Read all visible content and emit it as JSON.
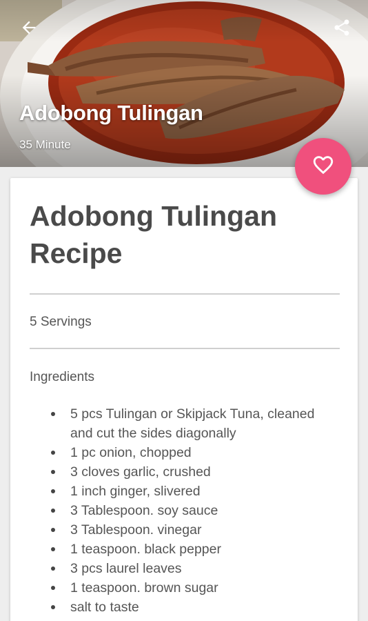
{
  "header": {
    "title": "Adobong Tulingan",
    "duration": "35 Minute",
    "back_icon": "arrow-left-icon",
    "share_icon": "share-icon",
    "favorite_icon": "heart-outline-icon",
    "accent_color": "#f0507d"
  },
  "recipe": {
    "title": "Adobong Tulingan Recipe",
    "servings": "5 Servings",
    "ingredients_heading": "Ingredients",
    "ingredients": [
      "5 pcs Tulingan or Skipjack Tuna, cleaned and cut the sides diagonally",
      "1 pc onion, chopped",
      "3 cloves garlic, crushed",
      "1 inch ginger, slivered",
      "3 Tablespoon. soy sauce",
      "3 Tablespoon. vinegar",
      "1 teaspoon. black pepper",
      "3 pcs laurel leaves",
      "1 teaspoon. brown sugar",
      "salt to taste"
    ]
  }
}
